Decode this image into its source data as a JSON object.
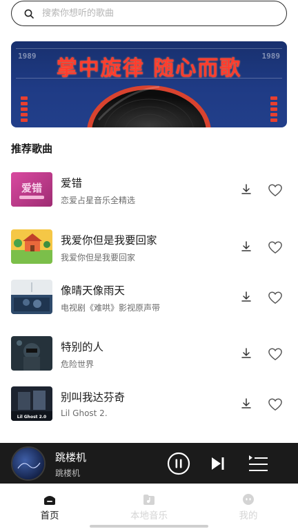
{
  "search": {
    "placeholder": "搜索你想听的歌曲",
    "icon": "search-icon"
  },
  "banner": {
    "title": "掌中旋律 随心而歌",
    "left_num": "1989",
    "right_num": "1989",
    "accent": "#ff3d2e"
  },
  "section": {
    "title": "推荐歌曲"
  },
  "songs": [
    {
      "name": "爱错",
      "subtitle": "恋爱占星音乐全精选"
    },
    {
      "name": "我爱你但是我要回家",
      "subtitle": "我爱你但是我要回家"
    },
    {
      "name": "像晴天像雨天",
      "subtitle": "电视剧《难哄》影视原声带"
    },
    {
      "name": "特别的人",
      "subtitle": "危险世界"
    },
    {
      "name": "别叫我达芬奇",
      "subtitle": "Lil Ghost 2.",
      "cover_text": "Lil Ghost 2.0"
    }
  ],
  "player": {
    "title": "跳楼机",
    "subtitle": "跳楼机"
  },
  "tabs": [
    {
      "label": "首页",
      "icon": "home-icon",
      "active": true
    },
    {
      "label": "本地音乐",
      "icon": "music-folder-icon",
      "active": false
    },
    {
      "label": "我的",
      "icon": "profile-icon",
      "active": false
    }
  ],
  "colors": {
    "active_tab": "#1a1a1a",
    "inactive_tab": "#d4d4d4",
    "player_bg": "#1b1b1b"
  }
}
